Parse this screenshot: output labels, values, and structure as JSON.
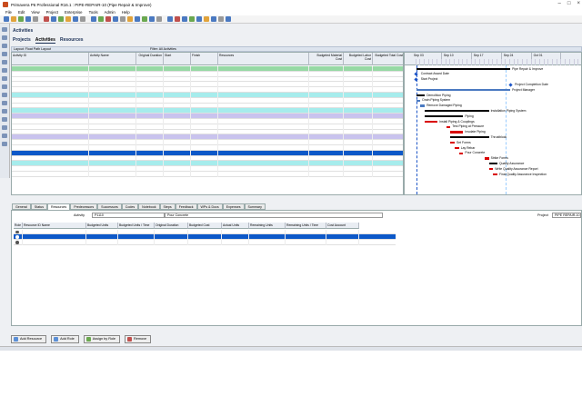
{
  "window": {
    "title": "Primavera P6 Professional R16.1 : PIPE-REPAIR-10 (Pipe Repair & Improve)"
  },
  "menu": [
    "File",
    "Edit",
    "View",
    "Project",
    "Enterprise",
    "Tools",
    "Admin",
    "Help"
  ],
  "page": {
    "title": "Activities",
    "tabs": [
      "Projects",
      "Activities",
      "Resources"
    ],
    "active_tab": "Activities"
  },
  "filter": {
    "layout": "Layout: Float Path Layout",
    "filter": "Filter: All Activities"
  },
  "grid": {
    "columns": [
      "Activity ID",
      "Activity Name",
      "Original Duration",
      "Start",
      "Finish",
      "Resources",
      "Budgeted Material Cost",
      "Budgeted Labor Cost",
      "Budgeted Total Cost"
    ],
    "rows": [
      {
        "kind": "wbs1",
        "indent": 0,
        "id": "Pipe Repair & Improve",
        "name": "",
        "dur": "16.00d",
        "start": "04-Sep-2017",
        "finish": "25-Sep-2017",
        "res": "",
        "mat": "$3,020.00",
        "lab": "$12,500.00",
        "tot": "$40,844.00"
      },
      {
        "kind": "act",
        "indent": 1,
        "id": "P1000",
        "name": "Contract Award Date",
        "dur": "0.00d",
        "start": "04-Sep-2017",
        "finish": "",
        "res": "",
        "mat": "$0.00",
        "lab": "$0.00",
        "tot": "$0.00"
      },
      {
        "kind": "act",
        "indent": 1,
        "id": "P1010",
        "name": "Start Project",
        "dur": "0.00d",
        "start": "04-Sep-2017",
        "finish": "",
        "res": "",
        "mat": "$0.00",
        "lab": "$0.00",
        "tot": "$0.00"
      },
      {
        "kind": "act",
        "indent": 1,
        "id": "P1020",
        "name": "Project Completion Date",
        "dur": "0.00d",
        "start": "",
        "finish": "25-Sep-2017",
        "res": "",
        "mat": "$0.00",
        "lab": "$0.00",
        "tot": "$0.00"
      },
      {
        "kind": "act",
        "indent": 1,
        "id": "P1030",
        "name": "Project Management",
        "dur": "16.00d",
        "start": "04-Sep-2017",
        "finish": "25-Sep-2017",
        "res": "Project Manager",
        "mat": "$0.00",
        "lab": "$12,760.00",
        "tot": "$12,760.00"
      },
      {
        "kind": "wbs2",
        "indent": 1,
        "id": "Demolition Piping",
        "name": "",
        "dur": "2.00d",
        "start": "04-Sep-2017",
        "finish": "05-Sep-2017",
        "res": "",
        "mat": "$0.00",
        "lab": "$1,664.00",
        "tot": "$1,664.00"
      },
      {
        "kind": "act",
        "indent": 2,
        "id": "P1040",
        "name": "Drain Piping System",
        "dur": "1.00d",
        "start": "04-Sep-2017",
        "finish": "04-Sep-2017",
        "res": "Common Laborer",
        "mat": "$0.00",
        "lab": "$472.00",
        "tot": "$472.00"
      },
      {
        "kind": "act",
        "indent": 2,
        "id": "P1050",
        "name": "Remove Damaged Piping",
        "dur": "1.00d",
        "start": "05-Sep-2017",
        "finish": "05-Sep-2017",
        "res": "Common Laborer, Pipe Fitter",
        "mat": "$0.00",
        "lab": "$1,192.00",
        "tot": "$1,192.00"
      },
      {
        "kind": "wbs2",
        "indent": 1,
        "id": "Installation Piping System",
        "name": "",
        "dur": "11.00d",
        "start": "06-Sep-2017",
        "finish": "20-Sep-2017",
        "res": "",
        "mat": "$3,020.00",
        "lab": "$16,080.00",
        "tot": "$24,100.00"
      },
      {
        "kind": "wbs3",
        "indent": 2,
        "id": "Piping",
        "name": "",
        "dur": "7.00d",
        "start": "06-Sep-2017",
        "finish": "14-Sep-2017",
        "res": "",
        "mat": "$5,400.00",
        "lab": "$12,040.00",
        "tot": "$17,440.00"
      },
      {
        "kind": "act",
        "indent": 3,
        "id": "P1060",
        "name": "Install Piping & Couplings",
        "dur": "3.00d",
        "start": "06-Sep-2017",
        "finish": "08-Sep-2017",
        "res": "Common Laborer, Pipe Fitter, Pipe Coupling, Pipe",
        "mat": "$2,200.00",
        "lab": "$3,576.00",
        "tot": "$5,776.00"
      },
      {
        "kind": "act",
        "indent": 3,
        "id": "P1070",
        "name": "Test Piping at Pressure",
        "dur": "1.00d",
        "start": "11-Sep-2017",
        "finish": "11-Sep-2017",
        "res": "Foreman, Common Laborer, Pipe Fitter, Project Manager",
        "mat": "$0.00",
        "lab": "$2,504.00",
        "tot": "$2,504.00"
      },
      {
        "kind": "act",
        "indent": 3,
        "id": "P1080",
        "name": "Insulate Piping",
        "dur": "3.00d",
        "start": "12-Sep-2017",
        "finish": "14-Sep-2017",
        "res": "Common Laborer, Pipe Fitter, Pipe Insulation, Pipe Insulation",
        "mat": "$3,200.00",
        "lab": "$5,880.00",
        "tot": "$9,080.00"
      },
      {
        "kind": "wbs3",
        "indent": 2,
        "id": "Thrustblock",
        "name": "",
        "dur": "7.00d",
        "start": "12-Sep-2017",
        "finish": "20-Sep-2017",
        "res": "",
        "mat": "$2,620.00",
        "lab": "$4,040.00",
        "tot": "$6,660.00"
      },
      {
        "kind": "act",
        "indent": 3,
        "id": "P1090",
        "name": "Set Forms",
        "dur": "1.00d",
        "start": "12-Sep-2017",
        "finish": "12-Sep-2017",
        "res": "Common Laborer, Pipe Fitter, Concrete Forms",
        "mat": "$320.00",
        "lab": "$1,192.00",
        "tot": "$1,512.00"
      },
      {
        "kind": "act",
        "indent": 3,
        "id": "P1100",
        "name": "Lay Rebar",
        "dur": "1.00d",
        "start": "13-Sep-2017",
        "finish": "13-Sep-2017",
        "res": "Common Laborer, Pipe Fitter, Rebar",
        "mat": "$300.00",
        "lab": "$1,192.00",
        "tot": "$1,492.00"
      },
      {
        "kind": "sel",
        "indent": 3,
        "id": "P1110",
        "name": "Pour Concrete",
        "dur": "1.00d",
        "start": "14-Sep-2017",
        "finish": "14-Sep-2017",
        "res": "Common Laborer, Pipe Fitter, Concrete",
        "mat": "$2,000.00",
        "lab": "$1,192.00",
        "tot": "$3,192.00"
      },
      {
        "kind": "act",
        "indent": 3,
        "id": "P1120",
        "name": "Strike Forms",
        "dur": "1.00d",
        "start": "20-Sep-2017",
        "finish": "20-Sep-2017",
        "res": "Common Laborer, Pipe Fitter",
        "mat": "$0.00",
        "lab": "$1,192.00",
        "tot": "$1,192.00"
      },
      {
        "kind": "wbs2",
        "indent": 1,
        "id": "Quality Assurance",
        "name": "",
        "dur": "2.00d",
        "start": "21-Sep-2017",
        "finish": "22-Sep-2017",
        "res": "",
        "mat": "$0.00",
        "lab": "$2,912.00",
        "tot": "$2,912.00"
      },
      {
        "kind": "act",
        "indent": 2,
        "id": "P1130",
        "name": "Write Quality Assurance Re",
        "dur": "1.00d",
        "start": "21-Sep-2017",
        "finish": "21-Sep-2017",
        "res": "Project Manager",
        "mat": "$0.00",
        "lab": "$1,520.00",
        "tot": "$1,520.00"
      },
      {
        "kind": "act",
        "indent": 2,
        "id": "P1140",
        "name": "Final Quality Assurance Insp",
        "dur": "1.00d",
        "start": "22-Sep-2017",
        "finish": "22-Sep-2017",
        "res": "Foreman, Project Manager",
        "mat": "$0.00",
        "lab": "$1,392.00",
        "tot": "$1,392.00"
      }
    ]
  },
  "gantt": {
    "weeks": [
      "Sep 03",
      "Sep 10",
      "Sep 17",
      "Sep 24",
      "Oct 01"
    ],
    "labels": [
      "Pipe Repair & Improve",
      "Contract Award Date",
      "Start Project",
      "Project Completion Date",
      "Project Manager",
      "Demolition Piping",
      "Drain Piping System",
      "Remove Damaged Piping",
      "Installation Piping System",
      "Piping",
      "Install Piping & Couplings",
      "Test Piping at Pressure",
      "Insulate Piping",
      "Thrustblock",
      "Set Forms",
      "Lay Rebar",
      "Pour Concrete",
      "Strike Forms",
      "Quality Assurance",
      "Write Quality Assurance Report",
      "Final Quality Assurance Inspection"
    ]
  },
  "detail": {
    "tabs": [
      "General",
      "Status",
      "Resources",
      "Predecessors",
      "Successors",
      "Codes",
      "Notebook",
      "Steps",
      "Feedback",
      "WPs & Docs",
      "Expenses",
      "Summary"
    ],
    "active_tab": "Resources",
    "activity_label": "Activity",
    "activity_id": "P1110",
    "activity_name": "Pour Concrete",
    "project_label": "Project",
    "project_id": "PIPE REPAIR-10",
    "columns": [
      "Role",
      "Resource ID Name",
      "Budgeted Units",
      "Budgeted Units / Time",
      "Original Duration",
      "Budgeted Cost",
      "Actual Units",
      "Remaining Units",
      "Remaining Units / Time",
      "Cost Account"
    ],
    "rows": [
      {
        "role": "",
        "res": "CLAB Common Laborer",
        "bu": "8.00h",
        "but": "8.00h/d",
        "od": "1.00d",
        "bc": "$472.00",
        "au": "0.00h",
        "ru": "8.00h",
        "rut": "8.00h/d",
        "ca": "",
        "sel": false
      },
      {
        "role": "",
        "res": "CONCRETE Concrete",
        "bu": "5.00CY",
        "but": "5.00CY/d",
        "od": "1.00d",
        "bc": "$2,000.00",
        "au": "0.00CY",
        "ru": "5.00CY",
        "rut": "5.00CY/d",
        "ca": "",
        "sel": true
      },
      {
        "role": "",
        "res": "STR Pipe Fitter",
        "bu": "8.00h",
        "but": "8.00h/d",
        "od": "1.00d",
        "bc": "$720.00",
        "au": "0.00h",
        "ru": "8.00h",
        "rut": "8.00h/d",
        "ca": "",
        "sel": false
      }
    ],
    "buttons": [
      "Add Resource",
      "Add Role",
      "Assign by Role",
      "Remove"
    ]
  },
  "colors": {
    "wbs1": "#96d9a4",
    "wbs2": "#a6ecec",
    "wbs3": "#c9c3ee",
    "selected": "#0c58c8",
    "critical": "#d90000",
    "summary": "#000000"
  }
}
